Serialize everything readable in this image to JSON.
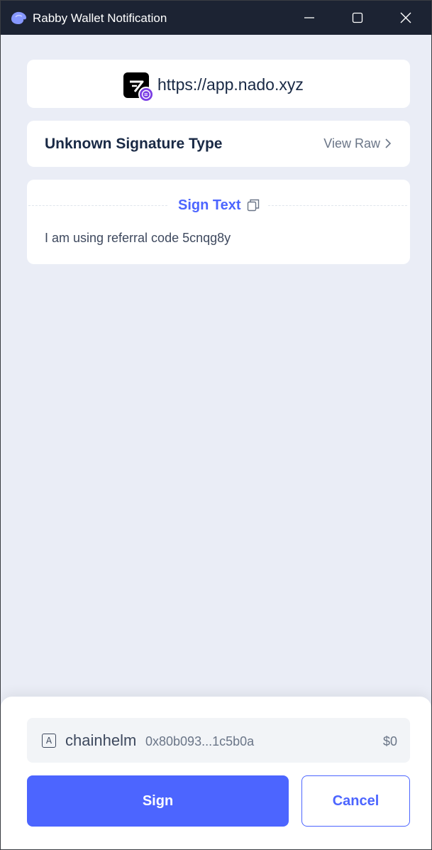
{
  "window": {
    "title": "Rabby Wallet Notification"
  },
  "origin": {
    "url": "https://app.nado.xyz"
  },
  "signature": {
    "type_title": "Unknown Signature Type",
    "view_raw_label": "View Raw"
  },
  "sign_text": {
    "header_label": "Sign Text",
    "message": "I am using referral code 5cnqg8y"
  },
  "account": {
    "icon_letter": "A",
    "name": "chainhelm",
    "address": "0x80b093...1c5b0a",
    "balance": "$0"
  },
  "actions": {
    "sign_label": "Sign",
    "cancel_label": "Cancel"
  },
  "colors": {
    "primary": "#4c65ff",
    "titlebar": "#1c2333",
    "background": "#eaedf6",
    "badge": "#7b3fe4"
  },
  "icons": {
    "app": "rabby-logo-icon",
    "minimize": "minimize-icon",
    "maximize": "maximize-icon",
    "close": "close-icon",
    "origin": "site-logo-icon",
    "chain_badge": "chain-badge-icon",
    "view_raw": "chevron-right-icon",
    "copy": "copy-icon",
    "account": "account-type-icon"
  }
}
